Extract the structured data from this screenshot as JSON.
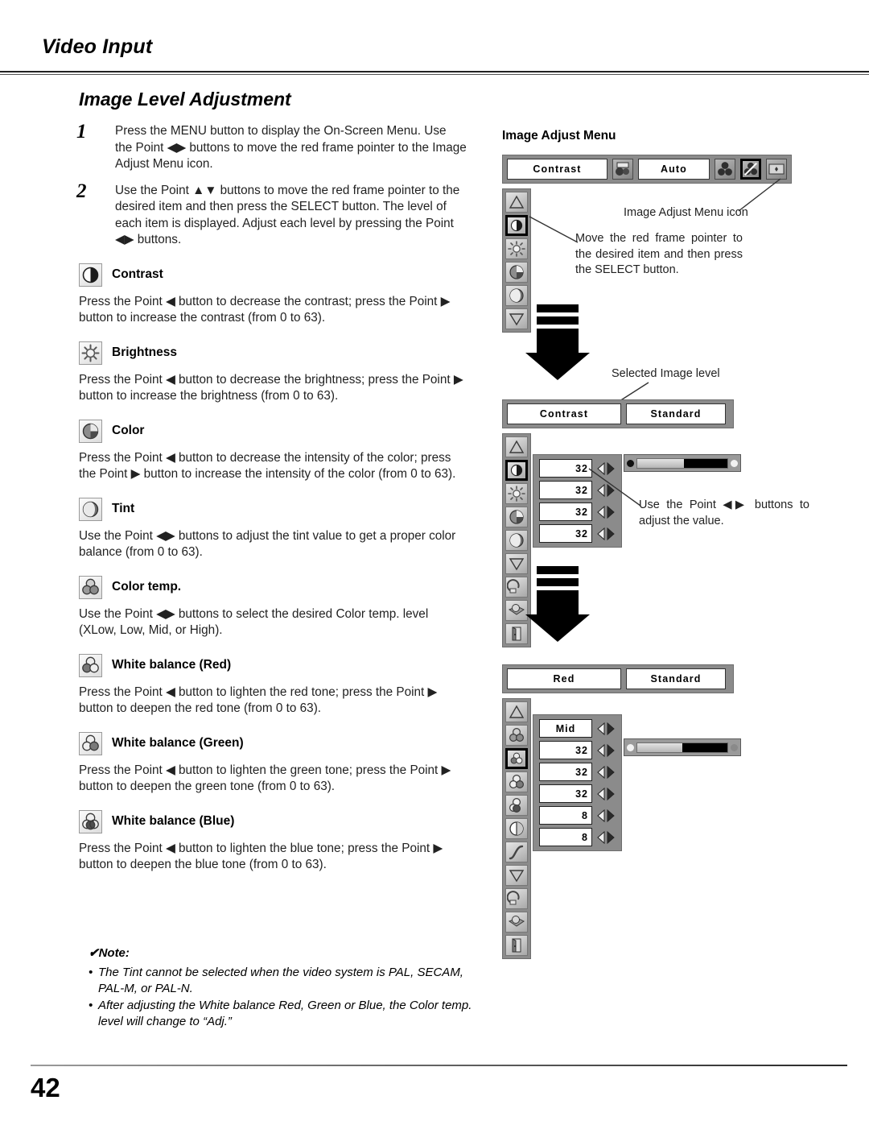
{
  "header": {
    "title": "Video Input"
  },
  "footer": {
    "page_number": "42"
  },
  "left": {
    "section_title": "Image Level Adjustment",
    "steps": [
      {
        "number": "1",
        "text": "Press the MENU button to display the On-Screen Menu. Use the Point ◀▶ buttons to move the red frame pointer to the Image Adjust Menu icon."
      },
      {
        "number": "2",
        "text": "Use the Point ▲▼ buttons to move the red frame pointer to the desired item and then press the SELECT button. The level of each item is displayed. Adjust each level by pressing the Point ◀▶ buttons."
      }
    ],
    "items": [
      {
        "icon": "contrast-icon",
        "label": "Contrast",
        "body": "Press the Point ◀ button to decrease the contrast; press the Point ▶ button to increase the contrast (from 0 to 63)."
      },
      {
        "icon": "brightness-icon",
        "label": "Brightness",
        "body": "Press the Point ◀ button to decrease the brightness; press the Point ▶ button to increase the brightness (from 0 to 63)."
      },
      {
        "icon": "color-icon",
        "label": "Color",
        "body": "Press the Point ◀ button to decrease the intensity of the color; press the Point ▶ button to increase the intensity of the color (from 0 to 63)."
      },
      {
        "icon": "tint-icon",
        "label": "Tint",
        "body": "Use the Point ◀▶ buttons to adjust the tint value to get a proper color balance (from 0 to 63)."
      },
      {
        "icon": "color-temp-icon",
        "label": "Color temp.",
        "body": "Use the Point ◀▶ buttons to select the desired Color temp. level (XLow, Low, Mid, or High)."
      },
      {
        "icon": "white-balance-red-icon",
        "label": "White balance (Red)",
        "body": "Press the Point ◀ button to lighten the red tone; press the Point ▶ button to deepen the red tone (from 0 to 63)."
      },
      {
        "icon": "white-balance-green-icon",
        "label": "White balance (Green)",
        "body": "Press the Point ◀ button to lighten the green tone; press the Point ▶ button to deepen the green tone (from 0 to 63)."
      },
      {
        "icon": "white-balance-blue-icon",
        "label": "White balance (Blue)",
        "body": "Press the Point ◀ button to lighten the blue tone; press the Point ▶ button to deepen the blue tone (from 0 to 63)."
      }
    ],
    "note": {
      "heading": "✔Note:",
      "bullets": [
        "The Tint cannot be selected when the video system is PAL, SECAM, PAL-M, or PAL-N.",
        "After adjusting the White balance Red, Green or Blue, the Color temp. level will change to “Adj.”"
      ]
    }
  },
  "right": {
    "diagram_title": "Image Adjust Menu",
    "panel1": {
      "menu_label": "Contrast",
      "status_value": "Auto",
      "top_icons": [
        "system-icon",
        "image-select-icon",
        "image-adjust-icon",
        "screen-icon"
      ],
      "selected_top_icon": "image-adjust-icon",
      "side_icons": [
        "up-arrow-icon",
        "contrast-icon",
        "brightness-icon",
        "color-icon",
        "tint-icon",
        "down-arrow-icon"
      ],
      "selected_side_icon": "contrast-icon",
      "callout_icon": "Image Adjust Menu icon",
      "callout_pointer": "Move the red frame pointer to the desired item and then press the SELECT button."
    },
    "panel2": {
      "menu_label": "Contrast",
      "level_label": "Standard",
      "level_callout": "Selected Image level",
      "values": [
        "32",
        "32",
        "32",
        "32"
      ],
      "slider_percent": 52,
      "side_icons": [
        "up-arrow-icon",
        "contrast-icon",
        "brightness-icon",
        "color-icon",
        "tint-icon",
        "down-arrow-icon",
        "reset-icon",
        "store-icon",
        "quit-icon"
      ],
      "selected_side_icon": "contrast-icon",
      "adjust_callout": "Use the Point ◀▶ buttons to adjust the value."
    },
    "panel3": {
      "menu_label": "Red",
      "level_label": "Standard",
      "values": [
        "Mid",
        "32",
        "32",
        "32",
        "8",
        "8"
      ],
      "slider_percent": 50,
      "side_icons": [
        "up-arrow-icon",
        "color-temp-icon",
        "white-balance-red-icon",
        "white-balance-green-icon",
        "white-balance-blue-icon",
        "sharpness-icon",
        "gamma-icon",
        "down-arrow-icon",
        "reset-icon",
        "store-icon",
        "quit-icon"
      ],
      "selected_side_icon": "white-balance-red-icon"
    }
  }
}
